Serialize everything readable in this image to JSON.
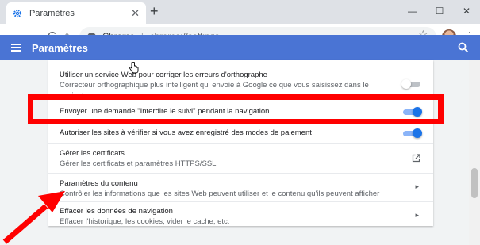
{
  "browser": {
    "tab_title": "Paramètres",
    "tab_close": "✕",
    "new_tab": "+",
    "window_controls": [
      "—",
      "☐",
      "✕"
    ],
    "back": "←",
    "forward": "→",
    "reload": "C",
    "home": "⌂",
    "omnibox_label": "Chrome",
    "omnibox_separator": "|",
    "omnibox_url": "chrome://settings",
    "bookmark_icon": "☆",
    "menu_icon": "⋮"
  },
  "header": {
    "title": "Paramètres"
  },
  "rows": [
    {
      "title": "Utiliser un service Web pour corriger les erreurs d'orthographe",
      "subtitle": "Correcteur orthographique plus intelligent qui envoie à Google ce que vous saisissez dans le",
      "subtitle2": "navigateur",
      "control": "toggle",
      "checked": false
    },
    {
      "title": "Envoyer une demande \"Interdire le suivi\" pendant la navigation",
      "control": "toggle",
      "checked": true
    },
    {
      "title": "Autoriser les sites à vérifier si vous avez enregistré des modes de paiement",
      "control": "toggle",
      "checked": true
    },
    {
      "title": "Gérer les certificats",
      "subtitle": "Gérer les certificats et paramètres HTTPS/SSL",
      "control": "external-link-icon"
    },
    {
      "title": "Paramètres du contenu",
      "subtitle": "Contrôler les informations que les sites Web peuvent utiliser et le contenu qu'ils peuvent afficher",
      "control": "chevron-right-icon",
      "chevron": "▸"
    },
    {
      "title": "Effacer les données de navigation",
      "subtitle": "Effacer l'historique, les cookies, vider le cache, etc.",
      "control": "chevron-right-icon",
      "chevron": "▸"
    }
  ],
  "annotations": {
    "highlight_color": "#ff0000",
    "arrow_color": "#ff0000"
  },
  "colors": {
    "header_blue": "#4a74d4",
    "toggle_on": "#1a73e8"
  }
}
